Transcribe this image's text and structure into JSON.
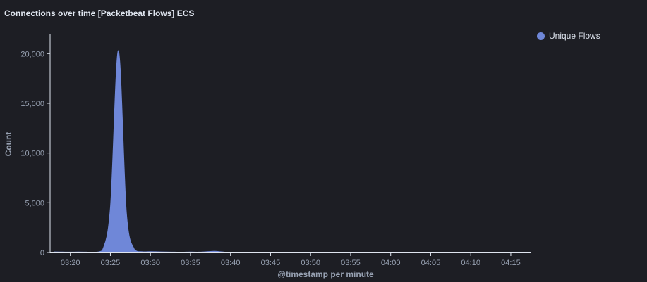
{
  "panel": {
    "title": "Connections over time [Packetbeat Flows] ECS"
  },
  "legend": {
    "position": "top-right",
    "items": [
      {
        "label": "Unique Flows",
        "color": "#6f87d8"
      }
    ]
  },
  "chart_data": {
    "type": "area",
    "title": "Connections over time [Packetbeat Flows] ECS",
    "xlabel": "@timestamp per minute",
    "ylabel": "Count",
    "x_ticks": [
      "03:20",
      "03:25",
      "03:30",
      "03:35",
      "03:40",
      "03:45",
      "03:50",
      "03:55",
      "04:00",
      "04:05",
      "04:10",
      "04:15"
    ],
    "y_ticks": [
      "0",
      "5,000",
      "10,000",
      "15,000",
      "20,000"
    ],
    "y_tick_values": [
      0,
      5000,
      10000,
      15000,
      20000
    ],
    "ylim": [
      0,
      22000
    ],
    "grid": false,
    "series": [
      {
        "name": "Unique Flows",
        "color": "#6f87d8",
        "x": [
          "03:18",
          "03:19",
          "03:20",
          "03:21",
          "03:22",
          "03:23",
          "03:24",
          "03:25",
          "03:26",
          "03:27",
          "03:28",
          "03:29",
          "03:30",
          "03:31",
          "03:32",
          "03:33",
          "03:34",
          "03:35",
          "03:36",
          "03:37",
          "03:38",
          "03:39",
          "03:40",
          "03:45",
          "03:50",
          "03:55",
          "04:00",
          "04:05",
          "04:10",
          "04:15",
          "04:17"
        ],
        "values": [
          60,
          50,
          40,
          50,
          40,
          30,
          200,
          4500,
          20300,
          4000,
          300,
          80,
          90,
          70,
          50,
          40,
          30,
          50,
          40,
          80,
          120,
          60,
          30,
          30,
          20,
          20,
          20,
          20,
          20,
          20,
          10
        ]
      }
    ]
  }
}
